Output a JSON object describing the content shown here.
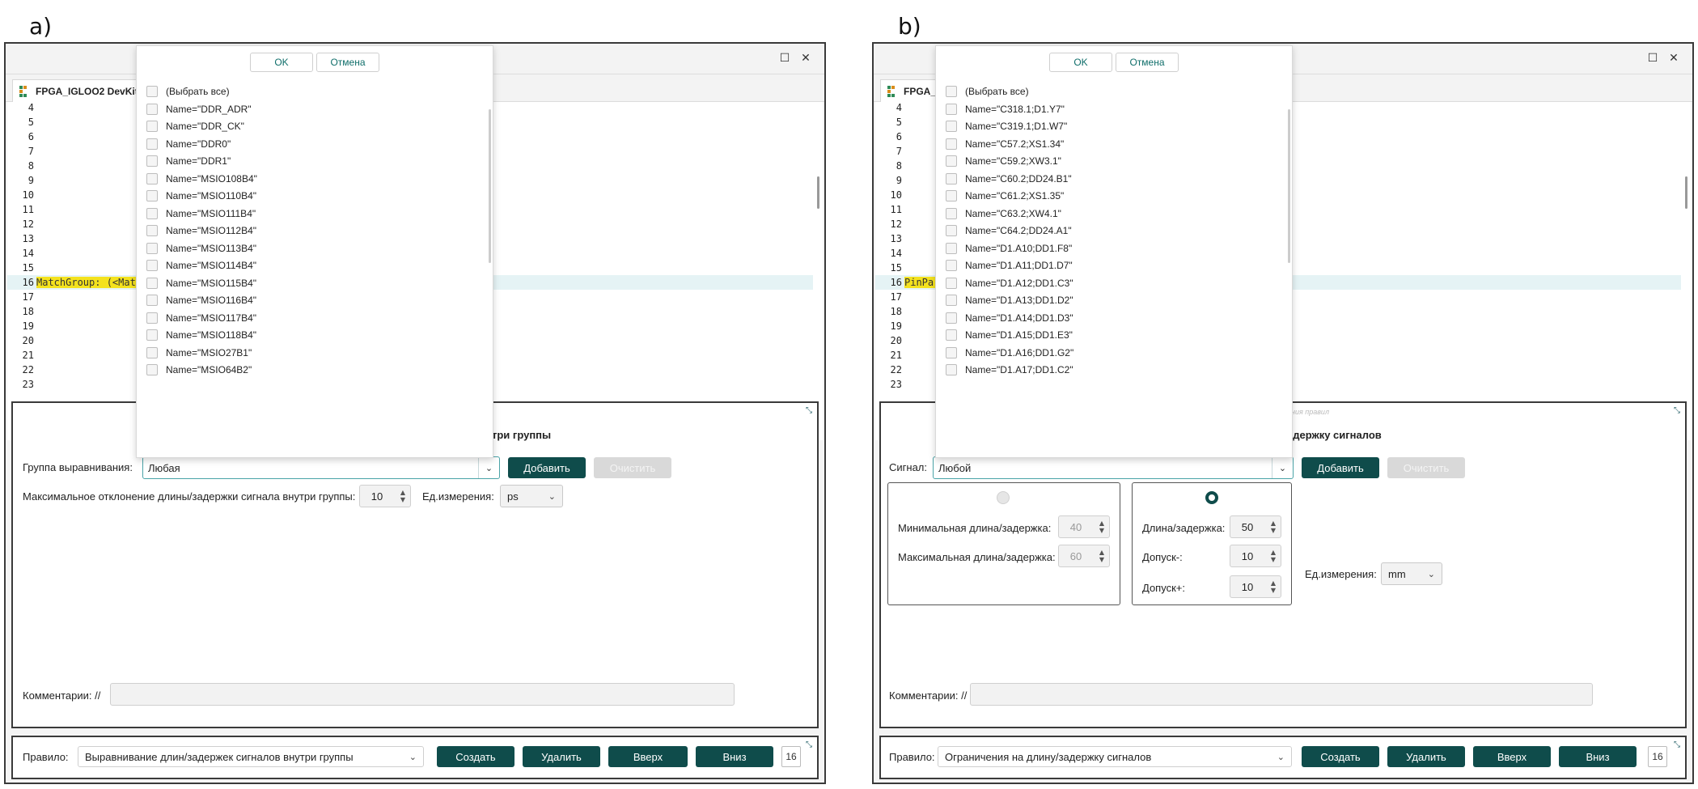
{
  "panel_a": {
    "letter": "a)",
    "tab_title": "FPGA_IGLOO2 DevKit",
    "line_numbers": [
      "4",
      "5",
      "6",
      "7",
      "8",
      "9",
      "10",
      "11",
      "12",
      "13",
      "14",
      "15",
      "16",
      "17",
      "18",
      "19",
      "20",
      "21",
      "22",
      "23"
    ],
    "highlight_code": "MatchGroup: (<Mat",
    "popup": {
      "ok": "OK",
      "cancel": "Отмена",
      "items": [
        "(Выбрать все)",
        "Name=\"DDR_ADR\"",
        "Name=\"DDR_CK\"",
        "Name=\"DDR0\"",
        "Name=\"DDR1\"",
        "Name=\"MSIO108B4\"",
        "Name=\"MSIO110B4\"",
        "Name=\"MSIO111B4\"",
        "Name=\"MSIO112B4\"",
        "Name=\"MSIO113B4\"",
        "Name=\"MSIO114B4\"",
        "Name=\"MSIO115B4\"",
        "Name=\"MSIO116B4\"",
        "Name=\"MSIO117B4\"",
        "Name=\"MSIO118B4\"",
        "Name=\"MSIO27B1\"",
        "Name=\"MSIO64B2\""
      ]
    },
    "section_title": "три группы",
    "group_label": "Группа выравнивания:",
    "group_value": "Любая",
    "add": "Добавить",
    "clear": "Очистить",
    "max_dev_label": "Максимальное отклонение длины/задержки сигнала внутри группы:",
    "max_dev_value": "10",
    "units_label": "Ед.измерения:",
    "units_value": "ps",
    "comments_label": "Комментарии: //",
    "rule_label": "Правило:",
    "rule_value": "Выравнивание длин/задержек сигналов внутри группы",
    "create": "Создать",
    "delete": "Удалить",
    "up": "Вверх",
    "down": "Вниз",
    "count": "16"
  },
  "panel_b": {
    "letter": "b)",
    "tab_title": "FPGA_",
    "line_numbers": [
      "4",
      "5",
      "6",
      "7",
      "8",
      "9",
      "10",
      "11",
      "12",
      "13",
      "14",
      "15",
      "16",
      "17",
      "18",
      "19",
      "20",
      "21",
      "22",
      "23"
    ],
    "highlight_code": "PinPa:",
    "popup": {
      "ok": "OK",
      "cancel": "Отмена",
      "items": [
        "(Выбрать все)",
        "Name=\"C318.1;D1.Y7\"",
        "Name=\"C319.1;D1.W7\"",
        "Name=\"C57.2;XS1.34\"",
        "Name=\"C59.2;XW3.1\"",
        "Name=\"C60.2;DD24.B1\"",
        "Name=\"C61.2;XS1.35\"",
        "Name=\"C63.2;XW4.1\"",
        "Name=\"C64.2;DD24.A1\"",
        "Name=\"D1.A10;DD1.F8\"",
        "Name=\"D1.A11;DD1.D7\"",
        "Name=\"D1.A12;DD1.C3\"",
        "Name=\"D1.A13;DD1.D2\"",
        "Name=\"D1.A14;DD1.D3\"",
        "Name=\"D1.A15;DD1.E3\"",
        "Name=\"D1.A16;DD1.G2\"",
        "Name=\"D1.A17;DD1.C2\""
      ]
    },
    "faint_text": "ения правил",
    "section_title": "адержку сигналов",
    "signal_label": "Сигнал:",
    "signal_value": "Любой",
    "add": "Добавить",
    "clear": "Очистить",
    "min_label": "Минимальная длина/задержка:",
    "min_value": "40",
    "max_label": "Максимальная длина/задержка:",
    "max_value": "60",
    "len_label": "Длина/задержка:",
    "len_value": "50",
    "tol_minus_label": "Допуск-:",
    "tol_minus_value": "10",
    "tol_plus_label": "Допуск+:",
    "tol_plus_value": "10",
    "units_label": "Ед.измерения:",
    "units_value": "mm",
    "comments_label": "Комментарии: //",
    "rule_label": "Правило:",
    "rule_value": "Ограничения на длину/задержку сигналов",
    "create": "Создать",
    "delete": "Удалить",
    "up": "Вверх",
    "down": "Вниз",
    "count": "16"
  },
  "colors": {
    "primary_button": "#0f4c4b",
    "focus_border": "#4aa3a7",
    "highlight_code_bg": "#f4e21d",
    "highlight_line_bg": "#e5f3f5"
  }
}
